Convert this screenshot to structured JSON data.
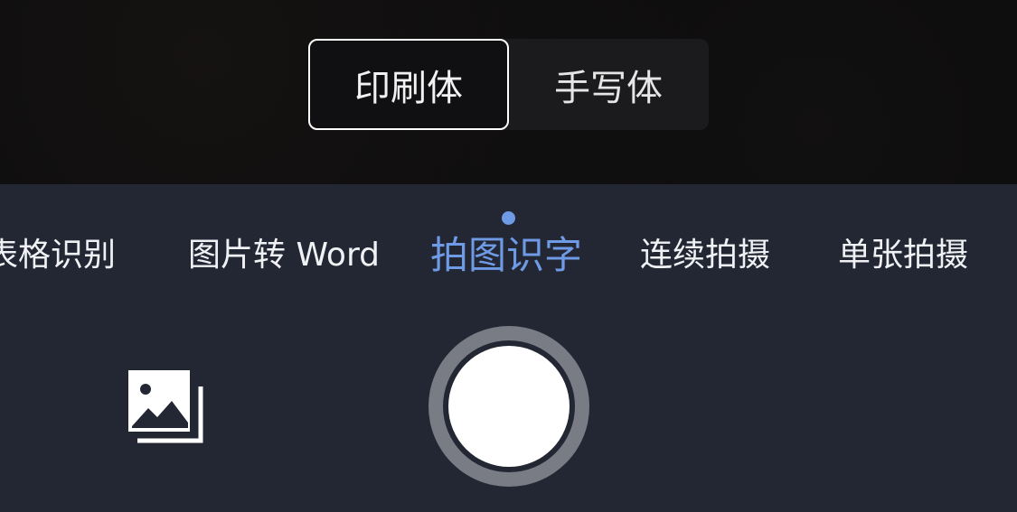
{
  "font_toggle": {
    "print_label": "印刷体",
    "handwriting_label": "手写体",
    "selected": "印刷体"
  },
  "modes": {
    "items": [
      {
        "label": "表格识别"
      },
      {
        "label": "图片转 Word"
      },
      {
        "label": "拍图识字"
      },
      {
        "label": "连续拍摄"
      },
      {
        "label": "单张拍摄"
      }
    ],
    "active": "拍图识字"
  },
  "controls": {
    "gallery_icon": "gallery-icon",
    "shutter_icon": "shutter-button"
  },
  "colors": {
    "accent": "#6f9ae6",
    "panel": "#232733",
    "viewfinder": "#0b0b0c"
  }
}
